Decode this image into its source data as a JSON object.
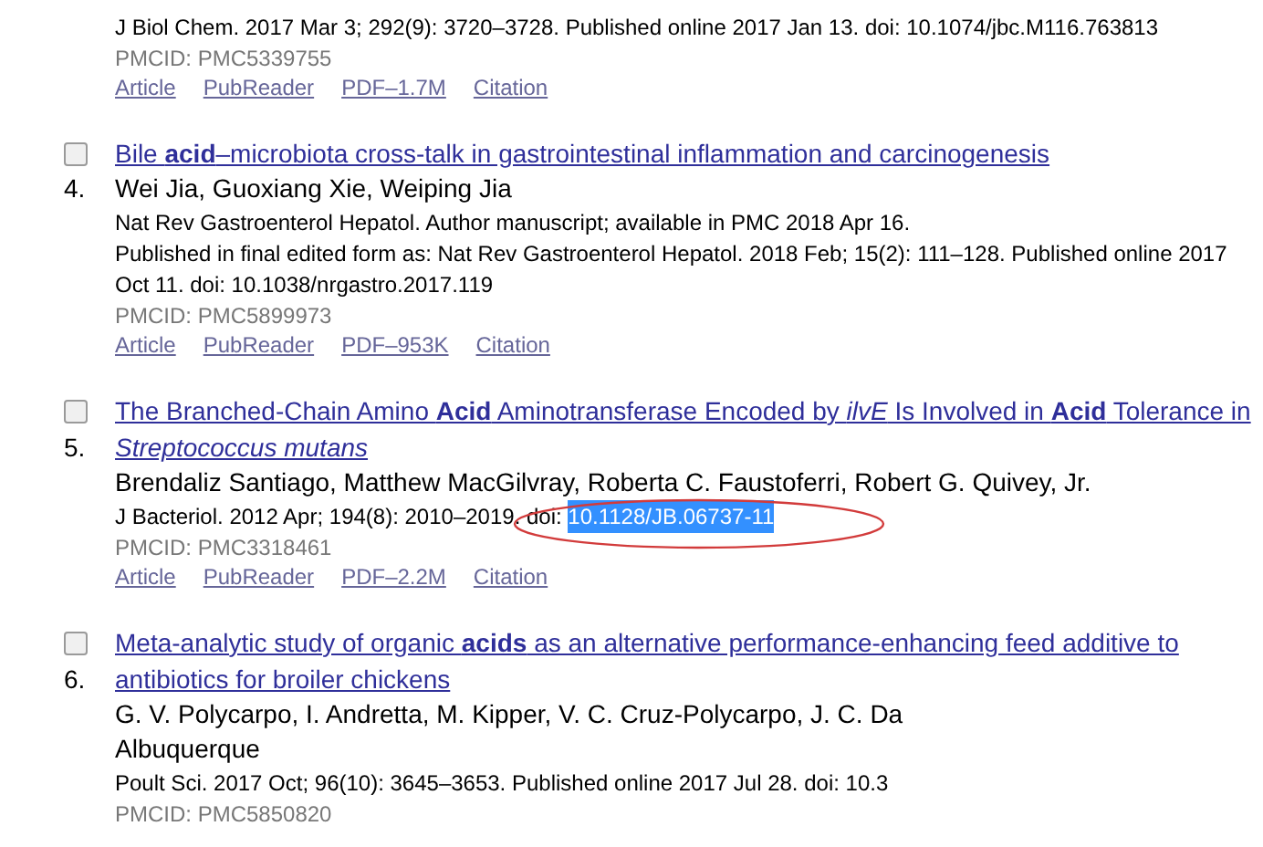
{
  "results": [
    {
      "citation_lines": [
        "J Biol Chem. 2017 Mar 3; 292(9): 3720–3728. Published online 2017 Jan 13. doi: 10.1074/jbc.M116.763813"
      ],
      "pmcid": "PMCID: PMC5339755",
      "links": [
        "Article",
        "PubReader",
        "PDF–1.7M",
        "Citation"
      ]
    },
    {
      "number": "4.",
      "title_lines": [
        "Bile **acid**–microbiota cross-talk in gastrointestinal inflammation and carcinogenesis"
      ],
      "checked": false,
      "authors_lines": [
        "Wei Jia, Guoxiang Xie, Weiping Jia"
      ],
      "citation_lines": [
        "Nat Rev Gastroenterol Hepatol. Author manuscript; available in PMC 2018 Apr 16.",
        "Published in final edited form as: Nat Rev Gastroenterol Hepatol. 2018 Feb; 15(2): 111–128. Published online 2017",
        "Oct 11. doi: 10.1038/nrgastro.2017.119"
      ],
      "pmcid": "PMCID: PMC5899973",
      "links": [
        "Article",
        "PubReader",
        "PDF–953K",
        "Citation"
      ]
    },
    {
      "number": "5.",
      "title_lines": [
        "The Branched-Chain Amino **Acid** Aminotransferase Encoded by *ilvE* Is Involved in **Acid** Tolerance in",
        "*Streptococcus mutans*"
      ],
      "checked": false,
      "authors_lines": [
        "Brendaliz Santiago, Matthew MacGilvray, Roberta C. Faustoferri, Robert G. Quivey, Jr."
      ],
      "citation_lines": [
        "J Bacteriol. 2012 Apr; 194(8): 2010–2019. doi: "
      ],
      "selected_text": "10.1128/JB.06737-11",
      "circled": true,
      "pmcid": "PMCID: PMC3318461",
      "links": [
        "Article",
        "PubReader",
        "PDF–2.2M",
        "Citation"
      ]
    },
    {
      "number": "6.",
      "title_lines": [
        "Meta-analytic study of organic **acids** as an alternative performance-enhancing feed additive to",
        "antibiotics for broiler chickens"
      ],
      "checked": false,
      "authors_lines": [
        "G. V. Polycarpo, I. Andretta, M. Kipper, V. C. Cruz-Polycarpo, J. C. Da",
        "Albuquerque"
      ],
      "citation_lines": [
        "Poult Sci. 2017 Oct; 96(10): 3645–3653. Published online 2017 Jul 28. doi: 10.3"
      ],
      "pmcid": "PMCID: PMC5850820"
    }
  ]
}
